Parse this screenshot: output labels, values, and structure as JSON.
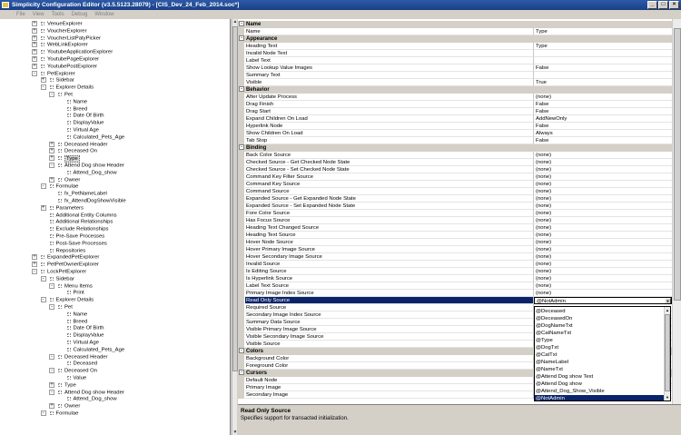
{
  "window": {
    "title": "Simplicity Configuration Editor (v3.5.5123.28079) - [CIS_Dev_24_Feb_2014.soc*]",
    "buttons": [
      "_",
      "□",
      "×"
    ]
  },
  "menu": [
    "File",
    "View",
    "Tools",
    "Debug",
    "Window"
  ],
  "tree": [
    {
      "label": "VenueExplorer",
      "indent": 0,
      "exp": "+"
    },
    {
      "label": "VoucherExplorer",
      "indent": 0,
      "exp": "+"
    },
    {
      "label": "VoucherListPatyPicker",
      "indent": 0,
      "exp": "+"
    },
    {
      "label": "WebLinkExplorer",
      "indent": 0,
      "exp": "+"
    },
    {
      "label": "YoutubeApplicationExplorer",
      "indent": 0,
      "exp": "+"
    },
    {
      "label": "YoutubePageExplorer",
      "indent": 0,
      "exp": "+"
    },
    {
      "label": "YoutubePostExplorer",
      "indent": 0,
      "exp": "+"
    },
    {
      "label": "PetExplorer",
      "indent": 0,
      "exp": "-"
    },
    {
      "label": "Sidebar",
      "indent": 1,
      "exp": "+"
    },
    {
      "label": "Explorer Details",
      "indent": 1,
      "exp": "-"
    },
    {
      "label": "Pet",
      "indent": 2,
      "exp": "-"
    },
    {
      "label": "Name",
      "indent": 3,
      "exp": ""
    },
    {
      "label": "Breed",
      "indent": 3,
      "exp": ""
    },
    {
      "label": "Date Of Birth",
      "indent": 3,
      "exp": ""
    },
    {
      "label": "DisplayValue",
      "indent": 3,
      "exp": ""
    },
    {
      "label": "Virtual Age",
      "indent": 3,
      "exp": ""
    },
    {
      "label": "Calculated_Pets_Age",
      "indent": 3,
      "exp": ""
    },
    {
      "label": "Deceased Header",
      "indent": 2,
      "exp": "+"
    },
    {
      "label": "Deceased On",
      "indent": 2,
      "exp": "+"
    },
    {
      "label": "Type",
      "indent": 2,
      "exp": "+",
      "selected": true
    },
    {
      "label": "Attend Dog show Header",
      "indent": 2,
      "exp": "-"
    },
    {
      "label": "Attend_Dog_show",
      "indent": 3,
      "exp": ""
    },
    {
      "label": "Owner",
      "indent": 2,
      "exp": "+"
    },
    {
      "label": "Formulae",
      "indent": 1,
      "exp": "-"
    },
    {
      "label": "fx_PetNameLabel",
      "indent": 2,
      "exp": ""
    },
    {
      "label": "fx_AttendDogShowVisible",
      "indent": 2,
      "exp": ""
    },
    {
      "label": "Parameters",
      "indent": 1,
      "exp": "+"
    },
    {
      "label": "Additional Entity Columns",
      "indent": 1,
      "exp": ""
    },
    {
      "label": "Additional Relationships",
      "indent": 1,
      "exp": ""
    },
    {
      "label": "Exclude Relationships",
      "indent": 1,
      "exp": ""
    },
    {
      "label": "Pre-Save Processes",
      "indent": 1,
      "exp": ""
    },
    {
      "label": "Post-Save Processes",
      "indent": 1,
      "exp": ""
    },
    {
      "label": "Repositories",
      "indent": 1,
      "exp": ""
    },
    {
      "label": "ExpandedPetExplorer",
      "indent": 0,
      "exp": "+"
    },
    {
      "label": "PetPetOwnerExplorer",
      "indent": 0,
      "exp": "+"
    },
    {
      "label": "LockPetExplorer",
      "indent": 0,
      "exp": "-"
    },
    {
      "label": "Sidebar",
      "indent": 1,
      "exp": "-"
    },
    {
      "label": "Menu Items",
      "indent": 2,
      "exp": "-"
    },
    {
      "label": "Print",
      "indent": 3,
      "exp": ""
    },
    {
      "label": "Explorer Details",
      "indent": 1,
      "exp": "-"
    },
    {
      "label": "Pet",
      "indent": 2,
      "exp": "-"
    },
    {
      "label": "Name",
      "indent": 3,
      "exp": ""
    },
    {
      "label": "Breed",
      "indent": 3,
      "exp": ""
    },
    {
      "label": "Date Of Birth",
      "indent": 3,
      "exp": ""
    },
    {
      "label": "DisplayValue",
      "indent": 3,
      "exp": ""
    },
    {
      "label": "Virtual Age",
      "indent": 3,
      "exp": ""
    },
    {
      "label": "Calculated_Pets_Age",
      "indent": 3,
      "exp": ""
    },
    {
      "label": "Deceased Header",
      "indent": 2,
      "exp": "-"
    },
    {
      "label": "Deceased",
      "indent": 3,
      "exp": ""
    },
    {
      "label": "Deceased On",
      "indent": 2,
      "exp": "-"
    },
    {
      "label": "Value",
      "indent": 3,
      "exp": ""
    },
    {
      "label": "Type",
      "indent": 2,
      "exp": "+"
    },
    {
      "label": "Attend Dog show Header",
      "indent": 2,
      "exp": "-"
    },
    {
      "label": "Attend_Dog_show",
      "indent": 3,
      "exp": ""
    },
    {
      "label": "Owner",
      "indent": 2,
      "exp": "+"
    },
    {
      "label": "Formulae",
      "indent": 1,
      "exp": "-"
    }
  ],
  "grid": [
    {
      "kind": "cat",
      "label": "Name"
    },
    {
      "kind": "row",
      "name": "Name",
      "value": "Type"
    },
    {
      "kind": "cat",
      "label": "Appearance"
    },
    {
      "kind": "row",
      "name": "Heading Text",
      "value": "Type"
    },
    {
      "kind": "row",
      "name": "Invalid Node Text",
      "value": ""
    },
    {
      "kind": "row",
      "name": "Label Text",
      "value": ""
    },
    {
      "kind": "row",
      "name": "Show Lookup Value Images",
      "value": "False"
    },
    {
      "kind": "row",
      "name": "Summary Text",
      "value": ""
    },
    {
      "kind": "row",
      "name": "Visible",
      "value": "True"
    },
    {
      "kind": "cat",
      "label": "Behavior"
    },
    {
      "kind": "row",
      "name": "After Update Process",
      "value": "(none)"
    },
    {
      "kind": "row",
      "name": "Drag Finish",
      "value": "False"
    },
    {
      "kind": "row",
      "name": "Drag Start",
      "value": "False"
    },
    {
      "kind": "row",
      "name": "Expand Children On Load",
      "value": "AddNewOnly"
    },
    {
      "kind": "row",
      "name": "Hyperlink Node",
      "value": "False"
    },
    {
      "kind": "row",
      "name": "Show Children On Load",
      "value": "Always"
    },
    {
      "kind": "row",
      "name": "Tab Stop",
      "value": "False"
    },
    {
      "kind": "cat",
      "label": "Binding"
    },
    {
      "kind": "row",
      "name": "Back Color Source",
      "value": "(none)"
    },
    {
      "kind": "row",
      "name": "Checked Source - Get Checked Node State",
      "value": "(none)"
    },
    {
      "kind": "row",
      "name": "Checked Source - Set Checked Node State",
      "value": "(none)"
    },
    {
      "kind": "row",
      "name": "Command Key Filter Source",
      "value": "(none)"
    },
    {
      "kind": "row",
      "name": "Command Key Source",
      "value": "(none)"
    },
    {
      "kind": "row",
      "name": "Command Source",
      "value": "(none)"
    },
    {
      "kind": "row",
      "name": "Expanded Source - Get Expanded Node State",
      "value": "(none)"
    },
    {
      "kind": "row",
      "name": "Expanded Source - Set Expanded Node State",
      "value": "(none)"
    },
    {
      "kind": "row",
      "name": "Fore Color Source",
      "value": "(none)"
    },
    {
      "kind": "row",
      "name": "Has Focus Source",
      "value": "(none)"
    },
    {
      "kind": "row",
      "name": "Heading Text Changed Source",
      "value": "(none)"
    },
    {
      "kind": "row",
      "name": "Heading Text Source",
      "value": "(none)"
    },
    {
      "kind": "row",
      "name": "Hover Node Source",
      "value": "(none)"
    },
    {
      "kind": "row",
      "name": "Hover Primary Image Source",
      "value": "(none)"
    },
    {
      "kind": "row",
      "name": "Hover Secondary Image Source",
      "value": "(none)"
    },
    {
      "kind": "row",
      "name": "Invalid Source",
      "value": "(none)"
    },
    {
      "kind": "row",
      "name": "Is Editing Source",
      "value": "(none)"
    },
    {
      "kind": "row",
      "name": "Is Hyperlink Source",
      "value": "(none)"
    },
    {
      "kind": "row",
      "name": "Label Text Source",
      "value": "(none)"
    },
    {
      "kind": "row",
      "name": "Primary Image Index Source",
      "value": "(none)"
    },
    {
      "kind": "row",
      "name": "Read Only Source",
      "value": "@NotAdmin",
      "selected": true
    },
    {
      "kind": "row",
      "name": "Required Source",
      "value": ""
    },
    {
      "kind": "row",
      "name": "Secondary Image Index Source",
      "value": ""
    },
    {
      "kind": "row",
      "name": "Summary Data Source",
      "value": ""
    },
    {
      "kind": "row",
      "name": "Visible Primary Image Source",
      "value": ""
    },
    {
      "kind": "row",
      "name": "Visible Secondary Image Source",
      "value": ""
    },
    {
      "kind": "row",
      "name": "Visible Source",
      "value": ""
    },
    {
      "kind": "cat",
      "label": "Colors"
    },
    {
      "kind": "row",
      "name": "Background Color",
      "value": ""
    },
    {
      "kind": "row",
      "name": "Foreground Color",
      "value": ""
    },
    {
      "kind": "cat",
      "label": "Cursors"
    },
    {
      "kind": "row",
      "name": "Default Node",
      "value": ""
    },
    {
      "kind": "row",
      "name": "Primary Image",
      "value": ""
    },
    {
      "kind": "row",
      "name": "Secondary Image",
      "value": ""
    }
  ],
  "dropdown": {
    "items": [
      "@Deceased",
      "@DeceasedOn",
      "@DogNameTxt",
      "@CatNameTxt",
      "@Type",
      "@DogTxt",
      "@CatTxt",
      "@NameLabel",
      "@NameTxt",
      "@Attend Dog show Text",
      "@Attend Dog show",
      "@Attend_Dog_Show_Visible",
      "@NotAdmin"
    ],
    "highlighted_index": 12,
    "grip": "⊿"
  },
  "description": {
    "title": "Read Only Source",
    "text": "Specifies support for transacted initialization."
  },
  "colors": {
    "selection": "#0a246a",
    "titlebar": "#1a3f86",
    "chrome": "#d4d0c8"
  }
}
